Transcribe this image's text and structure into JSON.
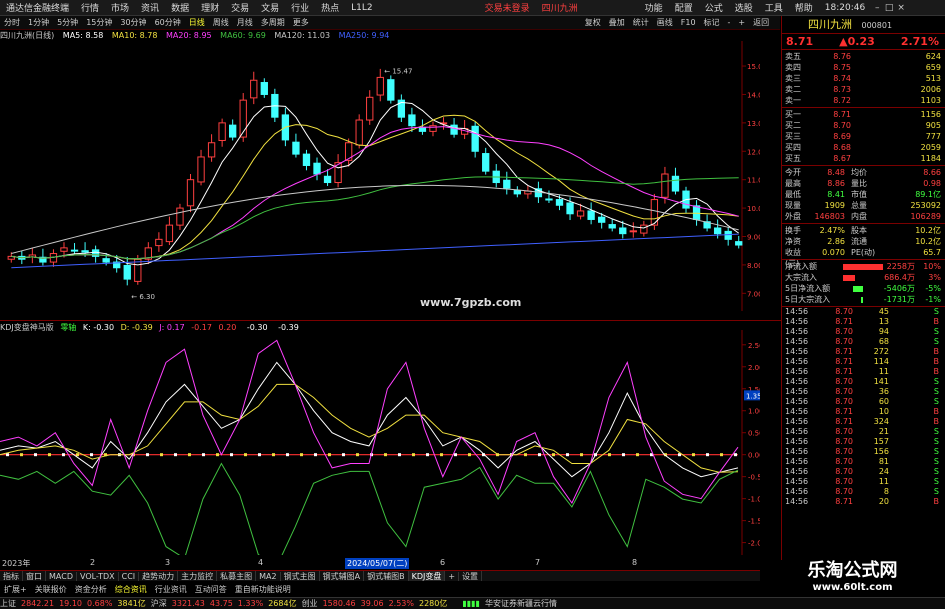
{
  "menubar": {
    "app_title": "通达信金融终端",
    "items": [
      "行情",
      "市场",
      "资讯",
      "数据",
      "理财",
      "交易",
      "文易",
      "行业",
      "热点",
      "L1L2"
    ],
    "notice": "交易未登录",
    "stock_name": "四川九洲",
    "right_items": [
      "功能",
      "配置",
      "公式",
      "选股",
      "工具",
      "帮助"
    ],
    "clock": "18:20:46"
  },
  "toolbar": {
    "periods": [
      "分时",
      "1分钟",
      "5分钟",
      "15分钟",
      "30分钟",
      "60分钟",
      "日线",
      "周线",
      "月线",
      "多周期",
      "更多"
    ],
    "active": "日线",
    "right_items": [
      "复权",
      "叠加",
      "统计",
      "画线",
      "F10",
      "标记",
      "-",
      "+",
      "返回"
    ]
  },
  "main_info": {
    "title": "四川九洲(日线)",
    "ma5": "MA5: 8.58",
    "ma10": "MA10: 8.78",
    "ma20": "MA20: 8.95",
    "ma60": "MA60: 9.69",
    "ma120": "MA120: 11.03",
    "ma250": "MA250: 9.94"
  },
  "kdj_info": {
    "title": "KDJ变盘神马版",
    "tag": "零轴",
    "k": "K: -0.30",
    "d": "D: -0.39",
    "j": "J: 0.17",
    "v1": "-0.17",
    "v2": "0.20",
    "v3": "-0.30",
    "v4": "-0.39"
  },
  "chart_data": [
    {
      "type": "candlestick",
      "title": "四川九洲(日线)",
      "y_ticks": [
        "15.00",
        "14.00",
        "13.00",
        "12.00",
        "11.00",
        "10.00",
        "9.00",
        "8.00",
        "7.00"
      ],
      "ylim": [
        6.8,
        15.6
      ],
      "annotations": [
        {
          "label": "15.47"
        },
        {
          "label": "6.30"
        }
      ],
      "series": [
        {
          "name": "MA5",
          "color": "#ffffff"
        },
        {
          "name": "MA10",
          "color": "#f0e040"
        },
        {
          "name": "MA20",
          "color": "#ff40ff"
        },
        {
          "name": "MA60",
          "color": "#40c040"
        },
        {
          "name": "MA120",
          "color": "#c8c8c8"
        },
        {
          "name": "MA250",
          "color": "#4060ff"
        }
      ],
      "close_path": [
        8.3,
        8.2,
        8.35,
        8.1,
        8.4,
        8.6,
        8.5,
        8.45,
        8.3,
        8.1,
        7.9,
        7.5,
        8.2,
        8.6,
        8.9,
        9.4,
        10.0,
        11.0,
        11.8,
        12.3,
        13.0,
        12.5,
        13.8,
        14.5,
        14.0,
        13.2,
        12.4,
        11.9,
        11.5,
        11.2,
        10.9,
        11.6,
        12.3,
        13.1,
        13.9,
        14.6,
        13.8,
        13.2,
        12.9,
        12.7,
        12.9,
        13.0,
        12.6,
        12.8,
        12.0,
        11.3,
        10.9,
        10.7,
        10.5,
        10.6,
        10.4,
        10.3,
        10.1,
        9.8,
        9.9,
        9.6,
        9.5,
        9.3,
        9.1,
        9.2,
        9.4,
        10.3,
        11.2,
        10.6,
        10.0,
        9.6,
        9.3,
        9.1,
        8.9,
        8.7
      ]
    },
    {
      "type": "line",
      "title": "KDJ变盘神马版",
      "y_ticks": [
        "2.50",
        "2.00",
        "1.50",
        "1.00",
        "0.50",
        "0.00",
        "-0.50",
        "-1.00",
        "-1.50",
        "-2.00"
      ],
      "ylim": [
        -2.1,
        2.7
      ],
      "marker": "1.35",
      "series": [
        {
          "name": "K",
          "color": "#ffffff",
          "values": [
            0.1,
            0.2,
            0.15,
            0.3,
            0.0,
            -0.3,
            0.3,
            -0.1,
            0.5,
            1.2,
            1.6,
            1.1,
            0.6,
            0.8,
            1.5,
            2.1,
            1.6,
            1.0,
            0.5,
            0.3,
            0.2,
            0.9,
            1.3,
            0.8,
            0.2,
            0.4,
            0.1,
            -0.3,
            0.1,
            0.3,
            -0.1,
            -0.5,
            -0.2,
            0.5,
            1.4,
            0.6,
            0.0,
            -0.3,
            -0.5,
            -0.4,
            -0.3
          ]
        },
        {
          "name": "D",
          "color": "#f0e040",
          "values": [
            0.0,
            0.1,
            0.15,
            0.2,
            0.1,
            -0.1,
            0.0,
            0.0,
            0.2,
            0.7,
            1.2,
            1.2,
            0.9,
            0.8,
            1.1,
            1.6,
            1.6,
            1.3,
            0.9,
            0.6,
            0.4,
            0.6,
            0.9,
            0.9,
            0.5,
            0.4,
            0.3,
            0.0,
            0.0,
            0.2,
            0.1,
            -0.2,
            -0.2,
            0.1,
            0.8,
            0.7,
            0.3,
            0.0,
            -0.3,
            -0.4,
            -0.39
          ]
        },
        {
          "name": "J",
          "color": "#ff40ff",
          "values": [
            0.3,
            0.4,
            0.2,
            0.5,
            -0.2,
            -0.7,
            0.8,
            -0.3,
            1.0,
            2.1,
            2.4,
            0.9,
            0.0,
            0.8,
            2.3,
            2.6,
            1.6,
            0.5,
            -0.3,
            -0.2,
            -0.2,
            1.5,
            2.1,
            0.6,
            -0.5,
            0.4,
            -0.1,
            -0.9,
            0.3,
            0.5,
            -0.5,
            -1.1,
            -0.2,
            1.3,
            2.1,
            0.4,
            -0.6,
            -0.9,
            -1.0,
            -0.4,
            0.17
          ]
        }
      ]
    }
  ],
  "date_axis": [
    "2023年",
    "2",
    "3",
    "4",
    "5",
    "6",
    "7",
    "8",
    "9"
  ],
  "date_highlight": "2024/05/07(二)",
  "watermark_url": "www.7gpzb.com",
  "right_panel": {
    "title": "四川九洲",
    "code": "000801",
    "price": "8.71",
    "change": "▲0.23",
    "change_pct": "2.71%",
    "asks": [
      {
        "label": "卖五",
        "price": "8.76",
        "vol": "624"
      },
      {
        "label": "卖四",
        "price": "8.75",
        "vol": "659"
      },
      {
        "label": "卖三",
        "price": "8.74",
        "vol": "513"
      },
      {
        "label": "卖二",
        "price": "8.73",
        "vol": "2006"
      },
      {
        "label": "卖一",
        "price": "8.72",
        "vol": "1103"
      }
    ],
    "bids": [
      {
        "label": "买一",
        "price": "8.71",
        "vol": "1156"
      },
      {
        "label": "买二",
        "price": "8.70",
        "vol": "905"
      },
      {
        "label": "买三",
        "price": "8.69",
        "vol": "777"
      },
      {
        "label": "买四",
        "price": "8.68",
        "vol": "2059"
      },
      {
        "label": "买五",
        "price": "8.67",
        "vol": "1184"
      }
    ],
    "stats": [
      {
        "l1": "今开",
        "v1": "8.48",
        "l2": "均价",
        "v2": "8.66"
      },
      {
        "l1": "最高",
        "v1": "8.86",
        "l2": "量比",
        "v2": "0.98"
      },
      {
        "l1": "最低",
        "v1": "8.41",
        "l2": "市值",
        "v2": "89.1亿"
      },
      {
        "l1": "现量",
        "v1": "1909",
        "l2": "总量",
        "v2": "253092"
      },
      {
        "l1": "外盘",
        "v1": "146803",
        "l2": "内盘",
        "v2": "106289"
      }
    ],
    "stats2": [
      {
        "l1": "换手",
        "v1": "2.47%",
        "l2": "股本",
        "v2": "10.2亿"
      },
      {
        "l1": "净资",
        "v1": "2.86",
        "l2": "流通",
        "v2": "10.2亿"
      },
      {
        "l1": "收益(三)",
        "v1": "0.070",
        "l2": "PE(动)",
        "v2": "65.7"
      }
    ],
    "flows": [
      {
        "label": "净流入额",
        "value": "2258万",
        "pct": "10%"
      },
      {
        "label": "大宗流入",
        "value": "686.4万",
        "pct": "3%"
      },
      {
        "label": "5日净流入额",
        "value": "-5406万",
        "pct": "-5%"
      },
      {
        "label": "5日大宗流入",
        "value": "-1731万",
        "pct": "-1%"
      }
    ],
    "ticks": [
      {
        "t": "14:56",
        "p": "8.70",
        "v": "45",
        "d": "S"
      },
      {
        "t": "14:56",
        "p": "8.71",
        "v": "13",
        "d": "B"
      },
      {
        "t": "14:56",
        "p": "8.70",
        "v": "94",
        "d": "S"
      },
      {
        "t": "14:56",
        "p": "8.70",
        "v": "68",
        "d": "S"
      },
      {
        "t": "14:56",
        "p": "8.71",
        "v": "272",
        "d": "B"
      },
      {
        "t": "14:56",
        "p": "8.71",
        "v": "114",
        "d": "B"
      },
      {
        "t": "14:56",
        "p": "8.71",
        "v": "11",
        "d": "B"
      },
      {
        "t": "14:56",
        "p": "8.70",
        "v": "141",
        "d": "S"
      },
      {
        "t": "14:56",
        "p": "8.70",
        "v": "36",
        "d": "S"
      },
      {
        "t": "14:56",
        "p": "8.70",
        "v": "60",
        "d": "S"
      },
      {
        "t": "14:56",
        "p": "8.71",
        "v": "10",
        "d": "B"
      },
      {
        "t": "14:56",
        "p": "8.71",
        "v": "324",
        "d": "B"
      },
      {
        "t": "14:56",
        "p": "8.70",
        "v": "21",
        "d": "S"
      },
      {
        "t": "14:56",
        "p": "8.70",
        "v": "157",
        "d": "S"
      },
      {
        "t": "14:56",
        "p": "8.70",
        "v": "156",
        "d": "S"
      },
      {
        "t": "14:56",
        "p": "8.70",
        "v": "81",
        "d": "S"
      },
      {
        "t": "14:56",
        "p": "8.70",
        "v": "24",
        "d": "S"
      },
      {
        "t": "14:56",
        "p": "8.70",
        "v": "11",
        "d": "S"
      },
      {
        "t": "14:56",
        "p": "8.70",
        "v": "8",
        "d": "S"
      },
      {
        "t": "14:56",
        "p": "8.71",
        "v": "20",
        "d": "B"
      }
    ]
  },
  "tabs": [
    "指标",
    "窗口",
    "MACD",
    "VOL-TDX",
    "CCI",
    "趋势动力",
    "主力监控",
    "私募主图",
    "MA2",
    "钢式主图",
    "钢式辅图A",
    "钢式辅图B",
    "钢式辅图A",
    "+",
    "设置"
  ],
  "tabs_active": "KDJ变盘",
  "subtabs": [
    "扩展+",
    "关联报价",
    "资金分析",
    "综合资讯",
    "行业资讯",
    "互动问答",
    "重自新功能说明"
  ],
  "statusbar": {
    "sh_label": "上证",
    "sh_val": "2842.21",
    "sh_chg": "19.10",
    "sh_pct": "0.68%",
    "sh_amt": "3841亿",
    "sz_label": "沪深",
    "sz_val": "3321.43",
    "sz_chg": "43.75",
    "sz_pct": "1.33%",
    "sz_amt": "2684亿",
    "cy_label": "创业",
    "cy_val": "1580.46",
    "cy_chg": "39.06",
    "cy_pct": "2.53%",
    "cy_amt": "2280亿",
    "broker": "华安证券新疆云行情"
  },
  "footer_brand": {
    "big": "乐淘公式网",
    "small": "www.60lt.com"
  },
  "colors": {
    "up": "#ff4040",
    "down": "#40ffff",
    "accent": "#f0e040",
    "frame": "#7a0000"
  }
}
